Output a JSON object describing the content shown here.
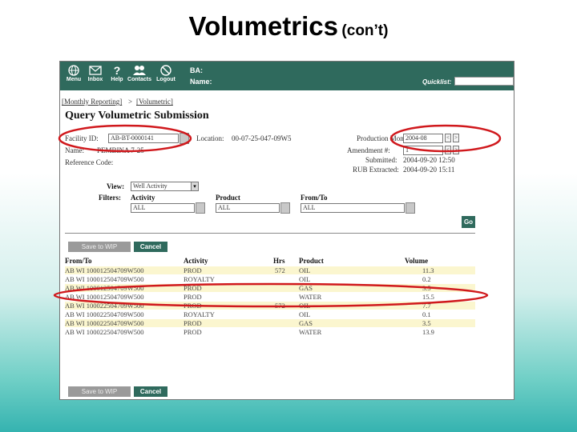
{
  "slide": {
    "title": "Volumetrics",
    "subtitle": "(con’t)"
  },
  "toolbar": {
    "menu": "Menu",
    "inbox": "Inbox",
    "help": "Help",
    "contacts": "Contacts",
    "logout": "Logout",
    "ba_label": "BA:",
    "name_label": "Name:",
    "quicklist_label": "Quicklist:"
  },
  "breadcrumb": {
    "parent": "[Monthly Reporting]",
    "separator": ">",
    "current": "[Volumetric]"
  },
  "page_title": "Query Volumetric Submission",
  "form": {
    "facility_label": "Facility ID:",
    "facility_value": "AB-BT-0000141",
    "location_label": "Location:",
    "location_value": "00-07-25-047-09W5",
    "production_month_label": "Production Month:",
    "production_month_value": "2004-08",
    "name_label": "Name:",
    "name_value": "PEMBINA 7-25",
    "amendment_label": "Amendment #:",
    "amendment_value": "1",
    "reference_code_label": "Reference Code:",
    "submitted_label": "Submitted:",
    "submitted_value": "2004-09-20 12:50",
    "rub_label": "RUB Extracted:",
    "rub_value": "2004-09-20 15:11",
    "view_label": "View:",
    "view_value": "Well Activity",
    "filters_label": "Filters:",
    "activity_label": "Activity",
    "activity_value": "ALL",
    "product_label": "Product",
    "product_value": "ALL",
    "fromto_label": "From/To",
    "fromto_value": "ALL",
    "go_label": "Go"
  },
  "actions": {
    "save_wip": "Save to WIP",
    "cancel": "Cancel"
  },
  "table": {
    "headers": {
      "from_to": "From/To",
      "activity": "Activity",
      "hrs": "Hrs",
      "product": "Product",
      "volume": "Volume"
    },
    "rows": [
      {
        "from_to": "AB WI 100012504709W500",
        "activity": "PROD",
        "hrs": "572",
        "product": "OIL",
        "volume": "11.3"
      },
      {
        "from_to": "AB WI 100012504709W500",
        "activity": "ROYALTY",
        "hrs": "",
        "product": "OIL",
        "volume": "0.2"
      },
      {
        "from_to": "AB WI 100012504709W500",
        "activity": "PROD",
        "hrs": "",
        "product": "GAS",
        "volume": "3.5"
      },
      {
        "from_to": "AB WI 100012504709W500",
        "activity": "PROD",
        "hrs": "",
        "product": "WATER",
        "volume": "15.5"
      },
      {
        "from_to": "AB WI 100022504709W500",
        "activity": "PROD",
        "hrs": "572",
        "product": "OIL",
        "volume": "7.7"
      },
      {
        "from_to": "AB WI 100022504709W500",
        "activity": "ROYALTY",
        "hrs": "",
        "product": "OIL",
        "volume": "0.1"
      },
      {
        "from_to": "AB WI 100022504709W500",
        "activity": "PROD",
        "hrs": "",
        "product": "GAS",
        "volume": "3.5"
      },
      {
        "from_to": "AB WI 100022504709W500",
        "activity": "PROD",
        "hrs": "",
        "product": "WATER",
        "volume": "13.9"
      }
    ]
  },
  "colors": {
    "toolbar": "#2f6a5d",
    "annotation": "#d0181c",
    "row_highlight": "#fbf6cf"
  }
}
